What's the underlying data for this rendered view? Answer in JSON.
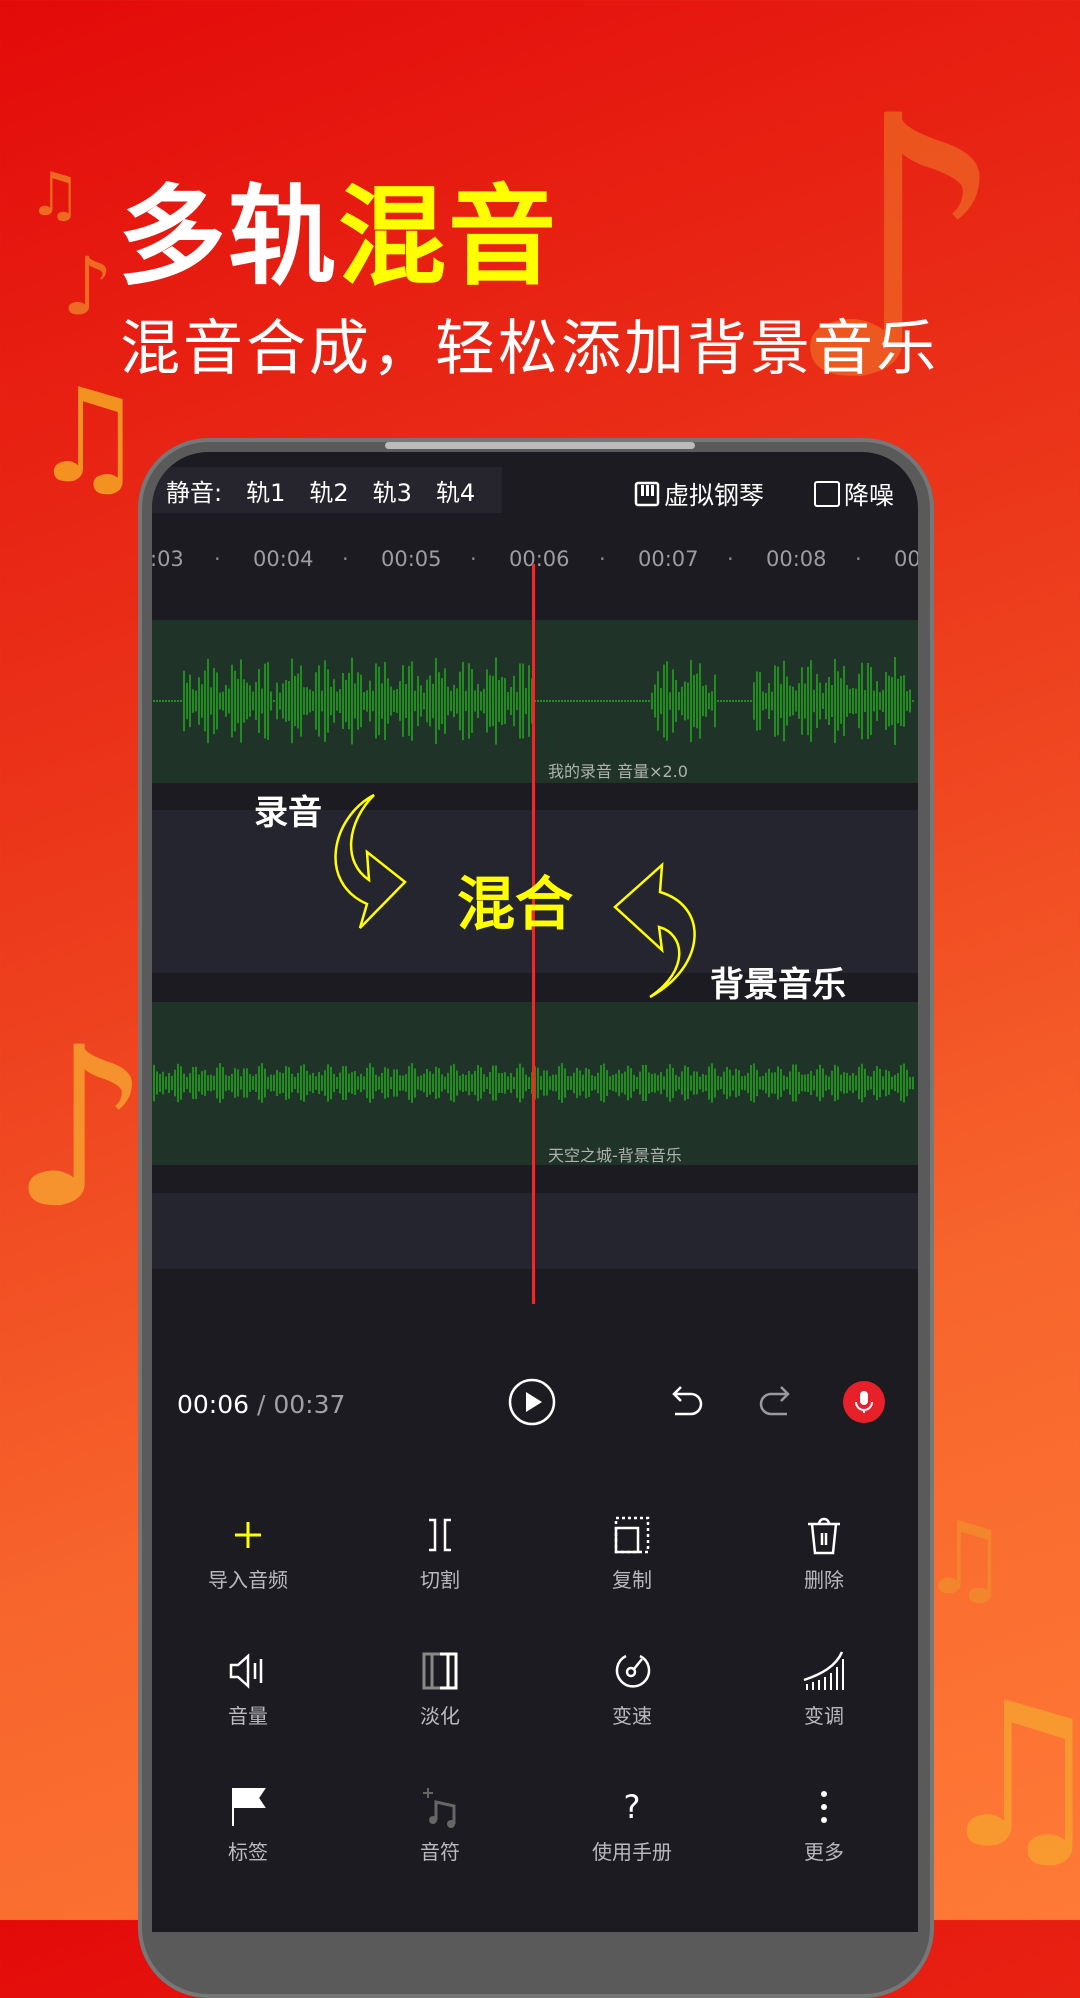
{
  "banner": {
    "headline_white": "多轨",
    "headline_yellow": "混音",
    "subtitle": "混音合成，轻松添加背景音乐"
  },
  "topbar": {
    "mute_label": "静音:",
    "tracks": [
      "轨1",
      "轨2",
      "轨3",
      "轨4"
    ],
    "piano_label": "虚拟钢琴",
    "denoise_label": "降噪"
  },
  "ruler": {
    "ticks": [
      ":03",
      "00:04",
      "00:05",
      "00:06",
      "00:07",
      "00:08",
      "00"
    ]
  },
  "tracks": [
    {
      "label": "我的录音 音量×2.0"
    },
    {
      "label": ""
    },
    {
      "label": "天空之城-背景音乐"
    },
    {
      "label": ""
    }
  ],
  "annotations": {
    "recording": "录音",
    "mix": "混合",
    "bgm": "背景音乐",
    "accent_color": "#ffff00"
  },
  "playback": {
    "current": "00:06",
    "separator": " / ",
    "total": "00:37",
    "record_color": "#e8202a"
  },
  "tools": [
    {
      "label": "导入音频",
      "icon": "plus-icon"
    },
    {
      "label": "切割",
      "icon": "cut-icon"
    },
    {
      "label": "复制",
      "icon": "copy-icon"
    },
    {
      "label": "删除",
      "icon": "trash-icon"
    },
    {
      "label": "音量",
      "icon": "volume-icon"
    },
    {
      "label": "淡化",
      "icon": "fade-icon"
    },
    {
      "label": "变速",
      "icon": "speed-icon"
    },
    {
      "label": "变调",
      "icon": "pitch-icon"
    },
    {
      "label": "标签",
      "icon": "flag-icon"
    },
    {
      "label": "音符",
      "icon": "music-note-icon"
    },
    {
      "label": "使用手册",
      "icon": "help-icon"
    },
    {
      "label": "更多",
      "icon": "more-icon"
    }
  ]
}
